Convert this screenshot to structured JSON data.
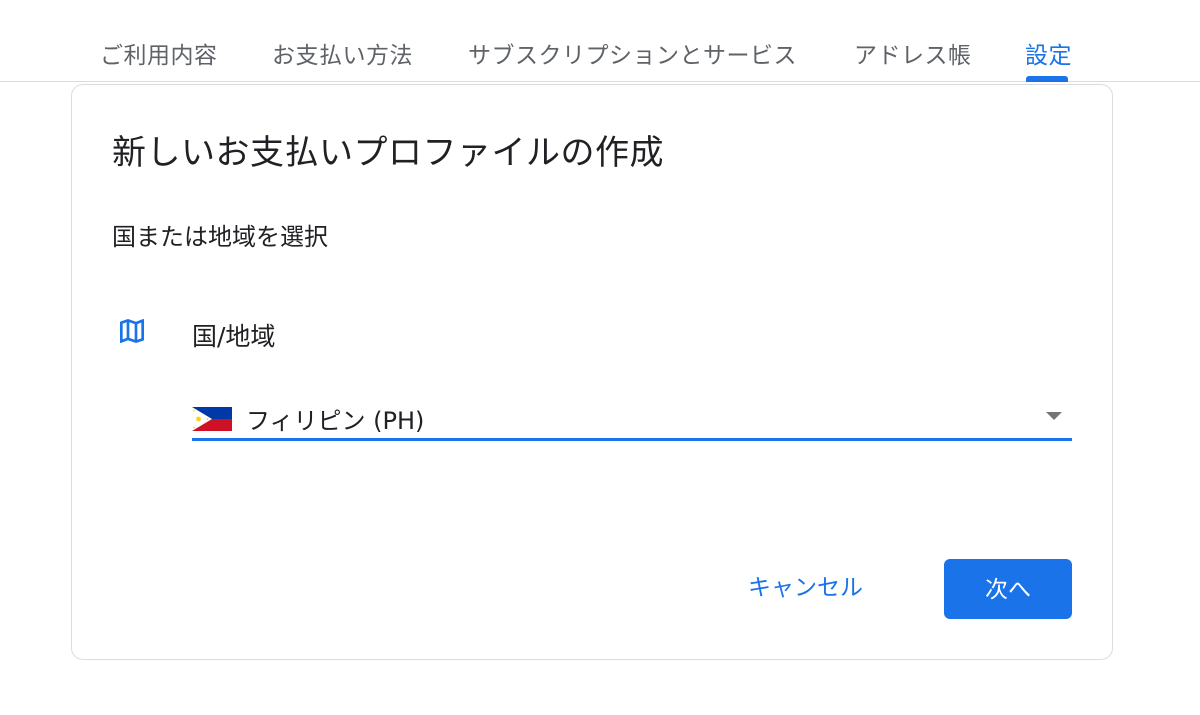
{
  "tabs": [
    {
      "label": "ご利用内容",
      "active": false
    },
    {
      "label": "お支払い方法",
      "active": false
    },
    {
      "label": "サブスクリプションとサービス",
      "active": false
    },
    {
      "label": "アドレス帳",
      "active": false
    },
    {
      "label": "設定",
      "active": true
    }
  ],
  "dialog": {
    "title": "新しいお支払いプロファイルの作成",
    "subtitle": "国または地域を選択",
    "field_icon": "map-icon",
    "field_label": "国/地域",
    "country": {
      "value": "フィリピン (PH)",
      "flag": "philippines-flag-icon"
    },
    "cancel_label": "キャンセル",
    "next_label": "次へ"
  },
  "colors": {
    "accent": "#1a73e8",
    "text": "#202124",
    "muted": "#5f6368",
    "border": "#dadce0"
  }
}
